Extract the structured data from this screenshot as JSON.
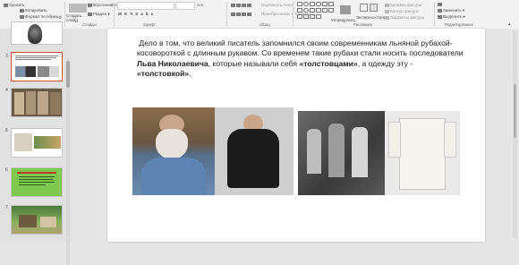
{
  "ribbon": {
    "clipboard": {
      "delete_label": "Удалить",
      "copy_label": "Копировать",
      "format_painter_label": "Формат по образцу",
      "group_label": "Буфер обмена"
    },
    "slides": {
      "new_slide_label": "Создать слайд",
      "reuse_label": "Восстановить",
      "section_label": "Раздел",
      "group_label": "Слайды"
    },
    "font": {
      "group_label": "Шрифт"
    },
    "paragraph": {
      "align_text_label": "Выровнять текст",
      "smartart_label": "Преобразовать в SmartArt",
      "group_label": "Абзац"
    },
    "drawing": {
      "arrange_label": "Упорядочить",
      "quick_styles_label": "Экспресс-стили",
      "shape_fill_label": "Заливка фигуры",
      "shape_outline_label": "Контур фигуры",
      "shape_effects_label": "Эффекты фигуры",
      "group_label": "Рисование"
    },
    "editing": {
      "replace_label": "Заменить",
      "select_label": "Выделить",
      "group_label": "Редактирование"
    }
  },
  "thumbnails": [
    {
      "number": "",
      "selected": false
    },
    {
      "number": "3",
      "selected": true
    },
    {
      "number": "4",
      "selected": false
    },
    {
      "number": "5",
      "selected": false
    },
    {
      "number": "6",
      "selected": false
    },
    {
      "number": "7",
      "selected": false
    }
  ],
  "slide": {
    "text_part1": "Дело в том, что великий писатель запомнился своим современникам льняной рубахой-косовороткой с длинным рукавом. Со временем такие рубахи стали носить последователи ",
    "text_bold1": "Льва Николаевича",
    "text_part2": ", которые называли себя ",
    "text_bold2": "«толстовцами»",
    "text_part3": ", а одежду эту - ",
    "text_bold3": "«толстовкой»",
    "text_part4": "."
  },
  "colors": {
    "selection": "#d35230",
    "ribbon_bg": "#f3f3f3",
    "workspace_bg": "#e6e6e6"
  }
}
